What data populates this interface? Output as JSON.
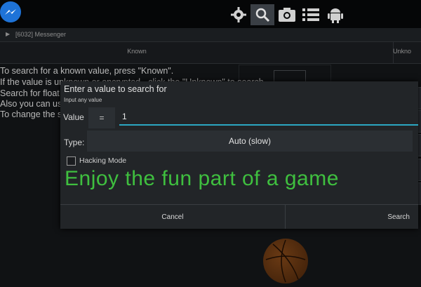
{
  "topbar": {
    "icons": [
      "messenger-app-icon",
      "gear-icon",
      "search-icon",
      "camera-icon",
      "list-icon",
      "android-icon"
    ]
  },
  "process": {
    "label": "[6032] Messenger"
  },
  "tabs": {
    "known": "Known",
    "unknown": "Unkno"
  },
  "help_lines": [
    "To search for a known value, press \"Known\".",
    "If the value is unknown or encrypted - click the \"Unknown\" to search",
    "Search for float",
    "Also you can us",
    "To change the s"
  ],
  "dialog": {
    "title": "Enter a value to search for",
    "subtitle": "Input any value",
    "value_label": "Value",
    "operator": "=",
    "value": "1",
    "type_label": "Type:",
    "type_value": "Auto (slow)",
    "hacking_mode_label": "Hacking Mode",
    "hacking_mode_checked": false,
    "cancel_label": "Cancel",
    "search_label": "Search"
  },
  "overlay_text": "Enjoy the fun part of a game",
  "colors": {
    "accent": "#2ca7c2",
    "overlay_green": "#3fbf3f"
  }
}
